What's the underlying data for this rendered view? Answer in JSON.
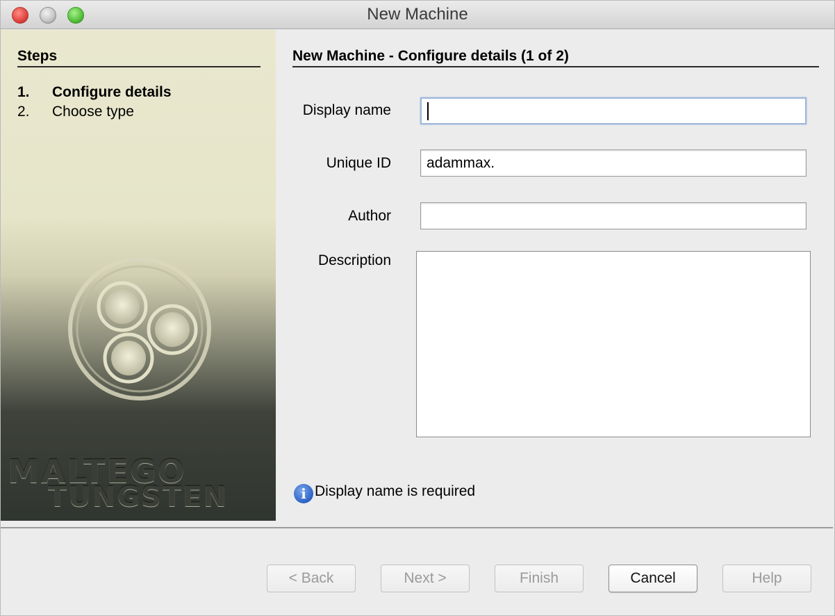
{
  "window": {
    "title": "New Machine"
  },
  "sidebar": {
    "title": "Steps",
    "steps": [
      {
        "num": "1.",
        "label": "Configure details"
      },
      {
        "num": "2.",
        "label": "Choose type"
      }
    ],
    "brand_line1": "MALTEGO",
    "brand_line2": "TUNGSTEN"
  },
  "main": {
    "title": "New Machine - Configure details (1 of 2)",
    "fields": {
      "display_name": {
        "label": "Display name",
        "value": ""
      },
      "unique_id": {
        "label": "Unique ID",
        "value": "adammax."
      },
      "author": {
        "label": "Author",
        "value": ""
      },
      "description": {
        "label": "Description",
        "value": ""
      }
    },
    "status_message": "Display name is required"
  },
  "buttons": {
    "back": "< Back",
    "next": "Next >",
    "finish": "Finish",
    "cancel": "Cancel",
    "help": "Help"
  },
  "colors": {
    "focus": "#9cb6dc",
    "info": "#2b62c6"
  }
}
